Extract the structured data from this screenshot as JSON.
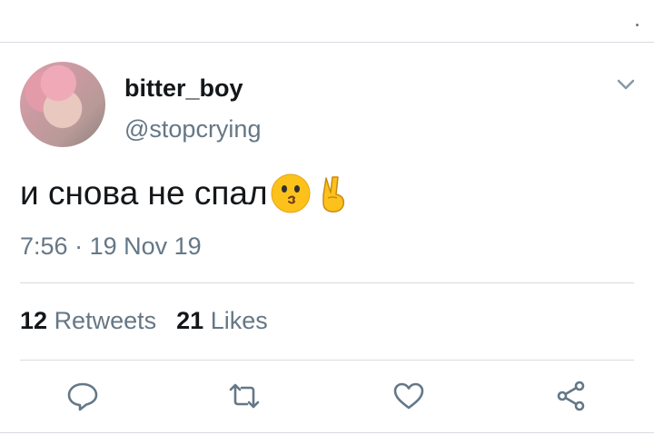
{
  "tweet": {
    "display_name": "bitter_boy",
    "handle": "@stopcrying",
    "text": "и снова не спал",
    "emojis": [
      "kissing-face-emoji",
      "victory-hand-emoji"
    ],
    "time": "7:56",
    "separator": "·",
    "date": "19 Nov 19"
  },
  "stats": {
    "retweets_count": "12",
    "retweets_label": "Retweets",
    "likes_count": "21",
    "likes_label": "Likes"
  },
  "actions": [
    "reply-icon",
    "retweet-icon",
    "like-icon",
    "share-icon"
  ],
  "colors": {
    "text": "#14171a",
    "secondary": "#657786",
    "divider": "#d6dbe0"
  }
}
